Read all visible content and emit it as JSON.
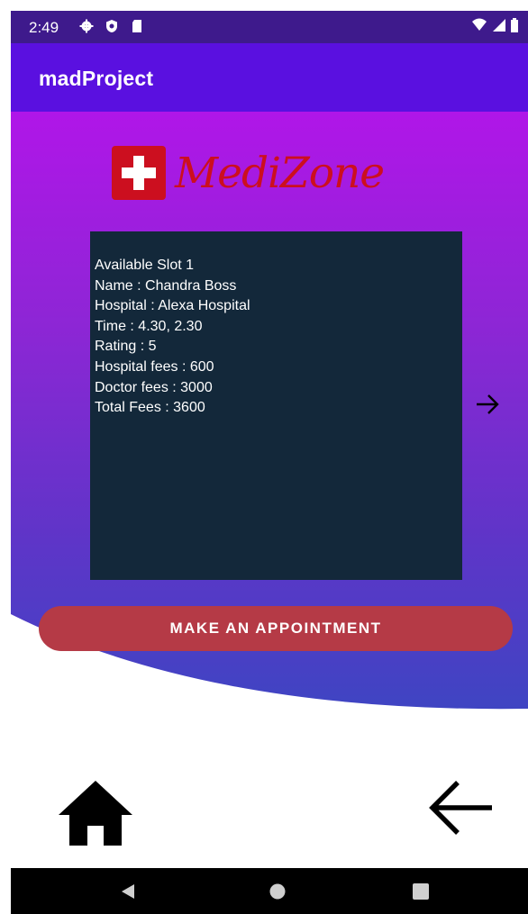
{
  "status_bar": {
    "time": "2:49",
    "left_icons": [
      "gear-icon",
      "shield-icon",
      "sd-card-icon"
    ],
    "right_icons": [
      "wifi-icon",
      "signal-icon",
      "battery-icon"
    ]
  },
  "app_bar": {
    "title": "madProject",
    "color": "#5a10e0"
  },
  "logo": {
    "text": "MediZone",
    "color": "#cc0f1f"
  },
  "slot": {
    "heading": "Available Slot 1",
    "name": "Name : Chandra Boss",
    "hospital": "Hospital : Alexa Hospital",
    "time": "Time : 4.30, 2.30",
    "rating": "Rating : 5",
    "hospital_fees": "Hospital fees : 600",
    "doctor_fees": "Doctor fees : 3000",
    "total_fees": "Total Fees : 3600"
  },
  "actions": {
    "appointment_label": "MAKE AN APPOINTMENT",
    "button_color": "#b53a46"
  },
  "bottom_icons": {
    "home": "home-icon",
    "back": "arrow-back-icon",
    "next": "arrow-forward-icon"
  },
  "nav_bar": [
    "nav-back-icon",
    "nav-home-icon",
    "nav-recents-icon"
  ]
}
